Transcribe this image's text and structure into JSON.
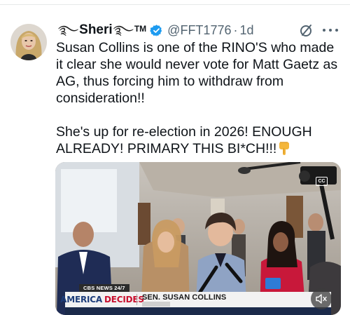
{
  "author": {
    "name": "Sheri",
    "tm": "TM",
    "handle": "@FFT1776",
    "separator": "·",
    "time": "1d"
  },
  "tweet": {
    "paragraph1": "Susan Collins is one of the RINO'S who made it clear she would never vote for Matt Gaetz as AG, thus forcing him to withdraw from consideration!!",
    "paragraph2": "She's up for re-election in 2026! ENOUGH ALREADY! PRIMARY THIS BI*CH!!!",
    "emoji": "pointing-down-hand"
  },
  "video": {
    "cbs_tag": "CBS NEWS 24/7",
    "program_word1": "AMERICA",
    "program_word2": "DECIDES",
    "lower_third_name": "SEN. SUSAN COLLINS",
    "cc_label": "CC",
    "icons": [
      "closed-captions-icon",
      "mute-icon"
    ]
  },
  "colors": {
    "verified_badge": "#1d9bf0",
    "secondary_text": "#536471",
    "america_blue": "#1d3d7a",
    "decides_red": "#c8102e"
  }
}
